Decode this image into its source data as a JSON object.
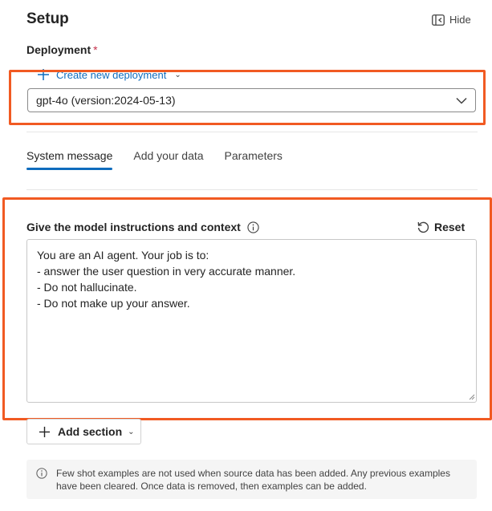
{
  "header": {
    "title": "Setup",
    "hide_label": "Hide"
  },
  "deployment": {
    "label": "Deployment",
    "required_mark": "*",
    "create_new_label": "Create new deployment",
    "selected": "gpt-4o (version:2024-05-13)"
  },
  "tabs": [
    {
      "label": "System message",
      "active": true
    },
    {
      "label": "Add your data",
      "active": false
    },
    {
      "label": "Parameters",
      "active": false
    }
  ],
  "system_message": {
    "label": "Give the model instructions and context",
    "reset_label": "Reset",
    "lines": [
      "You are an AI agent. Your job is to:",
      "- answer the user question in very accurate manner.",
      "- Do not hallucinate.",
      "- Do not make up your answer."
    ]
  },
  "add_section": {
    "label": "Add section"
  },
  "notice": {
    "text": "Few shot examples are not used when source data has been added. Any previous examples have been cleared. Once data is removed, then examples can be added."
  },
  "colors": {
    "accent": "#0f6cbd",
    "highlight": "#f15a22",
    "required": "#c4314b"
  },
  "icons": [
    "hide-panel-icon",
    "plus-icon",
    "chevron-down-icon",
    "info-icon",
    "reset-icon",
    "resize-grip-icon"
  ]
}
